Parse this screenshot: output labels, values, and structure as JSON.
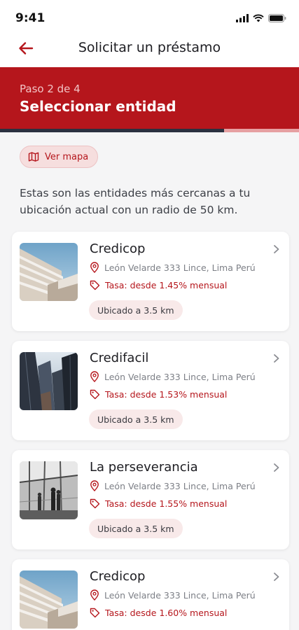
{
  "status_bar": {
    "time": "9:41"
  },
  "header": {
    "title": "Solicitar un préstamo"
  },
  "step": {
    "label": "Paso 2 de 4",
    "title": "Seleccionar entidad",
    "progress_fraction": 0.75
  },
  "map_chip": {
    "label": "Ver mapa"
  },
  "intro": {
    "text": "Estas son las entidades más cercanas  a tu ubicación actual con un radio de 50 km."
  },
  "entities": [
    {
      "name": "Credicop",
      "address": "León Velarde 333 Lince, Lima Perú",
      "rate_label": "Tasa:",
      "rate_value": "desde 1.45% mensual",
      "distance": "Ubicado a 3.5 km"
    },
    {
      "name": "Credifacil",
      "address": "León Velarde 333 Lince, Lima Perú",
      "rate_label": "Tasa:",
      "rate_value": "desde 1.53% mensual",
      "distance": "Ubicado a 3.5 km"
    },
    {
      "name": "La perseverancia",
      "address": "León Velarde 333 Lince, Lima Perú",
      "rate_label": "Tasa:",
      "rate_value": "desde 1.55% mensual",
      "distance": "Ubicado a 3.5 km"
    },
    {
      "name": "Credicop",
      "address": "León Velarde 333 Lince, Lima Perú",
      "rate_label": "Tasa:",
      "rate_value": "desde 1.60% mensual",
      "distance": "Ubicado a 3.5 km"
    }
  ],
  "colors": {
    "brand": "#b5161c",
    "progress": "#2b3140",
    "chip_bg": "#f6dede"
  },
  "icons": {
    "back": "arrow-left-icon",
    "map": "map-icon",
    "location": "location-pin-icon",
    "tag": "tag-icon",
    "chevron": "chevron-right-icon"
  }
}
